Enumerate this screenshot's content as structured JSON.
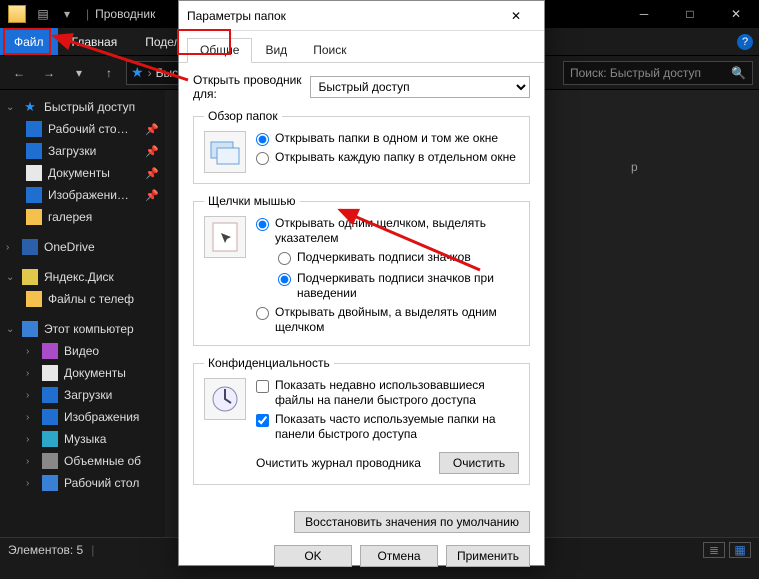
{
  "explorer": {
    "app_title": "Проводник",
    "ribbon": {
      "file": "Файл",
      "home": "Главная",
      "share": "Подел"
    },
    "address_label": "Быстр",
    "search_placeholder": "Поиск: Быстрый доступ"
  },
  "sidebar": {
    "quick_access": "Быстрый доступ",
    "items_qa": {
      "desktop": "Рабочий сто…",
      "downloads": "Загрузки",
      "documents": "Документы",
      "pictures": "Изображени…",
      "gallery": "галерея"
    },
    "onedrive": "OneDrive",
    "yadisk": "Яндекс.Диск",
    "yadisk_sub": "Файлы с телеф",
    "thispc": "Этот компьютер",
    "items_pc": {
      "video": "Видео",
      "documents": "Документы",
      "downloads": "Загрузки",
      "pictures": "Изображения",
      "music": "Музыка",
      "volumes": "Объемные об",
      "desktop": "Рабочий стол"
    }
  },
  "content": {
    "ghost": "р"
  },
  "status": {
    "items": "Элементов: 5"
  },
  "dialog": {
    "title": "Параметры папок",
    "tabs": {
      "general": "Общие",
      "view": "Вид",
      "search": "Поиск"
    },
    "open_for_label": "Открыть проводник\nдля:",
    "open_for_value": "Быстрый доступ",
    "browse": {
      "legend": "Обзор папок",
      "same_window": "Открывать папки в одном и том же окне",
      "new_window": "Открывать каждую папку в отдельном окне"
    },
    "click": {
      "legend": "Щелчки мышью",
      "single": "Открывать одним щелчком, выделять указателем",
      "underline_all": "Подчеркивать подписи значков",
      "underline_hover": "Подчеркивать подписи значков при наведении",
      "double": "Открывать двойным, а выделять одним щелчком"
    },
    "privacy": {
      "legend": "Конфиденциальность",
      "recent_files": "Показать недавно использовавшиеся файлы на панели быстрого доступа",
      "freq_folders": "Показать часто используемые папки на панели быстрого доступа",
      "clear_label": "Очистить журнал проводника",
      "clear_btn": "Очистить"
    },
    "defaults_btn": "Восстановить значения по умолчанию",
    "ok": "OK",
    "cancel": "Отмена",
    "apply": "Применить"
  }
}
